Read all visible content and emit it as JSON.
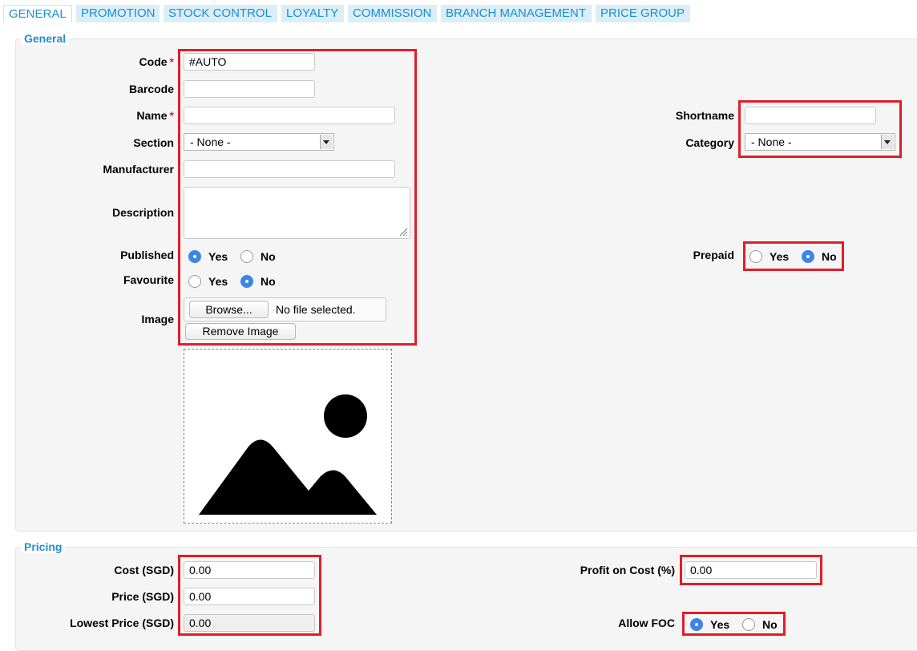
{
  "tabs": [
    {
      "label": "GENERAL",
      "active": true
    },
    {
      "label": "PROMOTION",
      "active": false
    },
    {
      "label": "STOCK CONTROL",
      "active": false
    },
    {
      "label": "LOYALTY",
      "active": false
    },
    {
      "label": "COMMISSION",
      "active": false
    },
    {
      "label": "BRANCH MANAGEMENT",
      "active": false
    },
    {
      "label": "PRICE GROUP",
      "active": false
    }
  ],
  "general": {
    "legend": "General",
    "code": {
      "label": "Code",
      "required": "*",
      "value": "#AUTO"
    },
    "barcode": {
      "label": "Barcode",
      "value": ""
    },
    "name": {
      "label": "Name",
      "required": "*",
      "value": ""
    },
    "section": {
      "label": "Section",
      "value": "- None -"
    },
    "manufacturer": {
      "label": "Manufacturer",
      "value": ""
    },
    "description": {
      "label": "Description",
      "value": ""
    },
    "published": {
      "label": "Published",
      "yes": "Yes",
      "no": "No",
      "selected": "Yes"
    },
    "favourite": {
      "label": "Favourite",
      "yes": "Yes",
      "no": "No",
      "selected": "No"
    },
    "image": {
      "label": "Image",
      "browse": "Browse...",
      "no_file": "No file selected.",
      "remove": "Remove Image",
      "placeholder_icon": "image-placeholder-icon"
    },
    "shortname": {
      "label": "Shortname",
      "value": ""
    },
    "category": {
      "label": "Category",
      "value": "- None -"
    },
    "prepaid": {
      "label": "Prepaid",
      "yes": "Yes",
      "no": "No",
      "selected": "No"
    }
  },
  "pricing": {
    "legend": "Pricing",
    "cost": {
      "label": "Cost (SGD)",
      "value": "0.00"
    },
    "price": {
      "label": "Price (SGD)",
      "value": "0.00"
    },
    "lowest_price": {
      "label": "Lowest Price (SGD)",
      "value": "0.00"
    },
    "profit_on_cost": {
      "label": "Profit on Cost (%)",
      "value": "0.00"
    },
    "allow_foc": {
      "label": "Allow FOC",
      "yes": "Yes",
      "no": "No",
      "selected": "Yes"
    }
  },
  "colors": {
    "accent": "#1f8fcf",
    "highlight": "#e01e28",
    "radio_on": "#3b86e6"
  }
}
